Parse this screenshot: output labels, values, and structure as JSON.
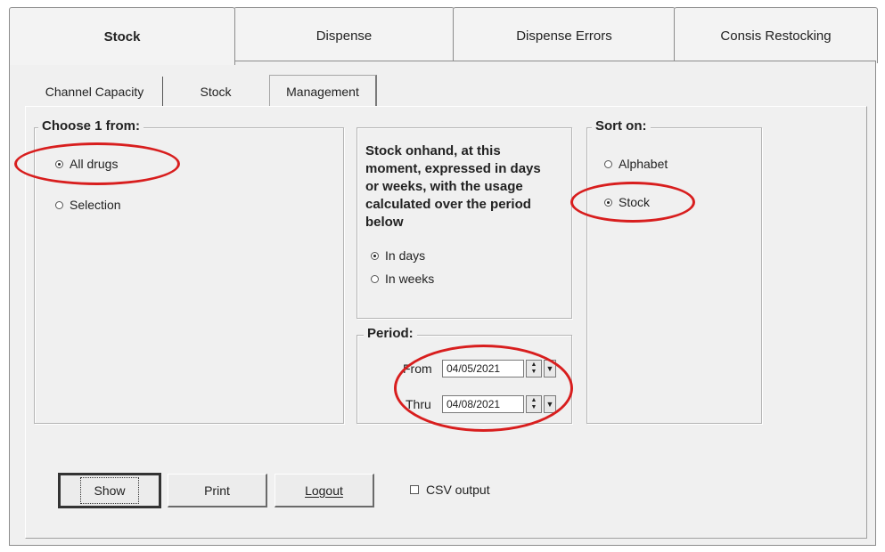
{
  "top_tabs": [
    {
      "label": "Stock",
      "active": true
    },
    {
      "label": "Dispense",
      "active": false
    },
    {
      "label": "Dispense Errors",
      "active": false
    },
    {
      "label": "Consis Restocking",
      "active": false
    }
  ],
  "sub_tabs": [
    {
      "label": "Channel Capacity",
      "active": false
    },
    {
      "label": "Stock",
      "active": false
    },
    {
      "label": "Management",
      "active": true
    }
  ],
  "choose_group": {
    "title": "Choose 1 from:",
    "options": [
      {
        "label": "All drugs",
        "selected": true
      },
      {
        "label": "Selection",
        "selected": false
      }
    ]
  },
  "stock_onhand": {
    "description": "Stock onhand, at this moment, expressed in days or weeks, with the usage calculated over the period below",
    "options": [
      {
        "label": "In days",
        "selected": true
      },
      {
        "label": "In weeks",
        "selected": false
      }
    ]
  },
  "period": {
    "title": "Period:",
    "from_label": "From",
    "from_value": "04/05/2021",
    "thru_label": "Thru",
    "thru_value": "04/08/2021"
  },
  "sort": {
    "title": "Sort on:",
    "options": [
      {
        "label": "Alphabet",
        "selected": false
      },
      {
        "label": "Stock",
        "selected": true
      }
    ]
  },
  "actions": {
    "show_label": "Show",
    "print_label": "Print",
    "logout_label": "Logout",
    "csv_label": "CSV output",
    "csv_checked": false
  },
  "annotation_color": "#d81e1e"
}
